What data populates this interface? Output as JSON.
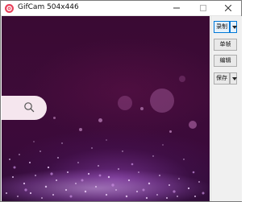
{
  "window": {
    "title": "GifCam 504x446",
    "controls": {
      "minimize_icon": "minimize-icon",
      "maximize_icon": "maximize-icon",
      "close_icon": "close-icon"
    }
  },
  "toolbar": {
    "record_label": "录制",
    "frame_label": "单帧",
    "edit_label": "编辑",
    "save_label": "保存"
  },
  "capture_area": {
    "background": "purple bokeh particles",
    "search_icon": "search-icon"
  },
  "colors": {
    "accent": "#0078d7",
    "app_icon": "#e8415b",
    "canvas_bg": "#3a0a33",
    "panel_bg": "#f0f0f0"
  }
}
